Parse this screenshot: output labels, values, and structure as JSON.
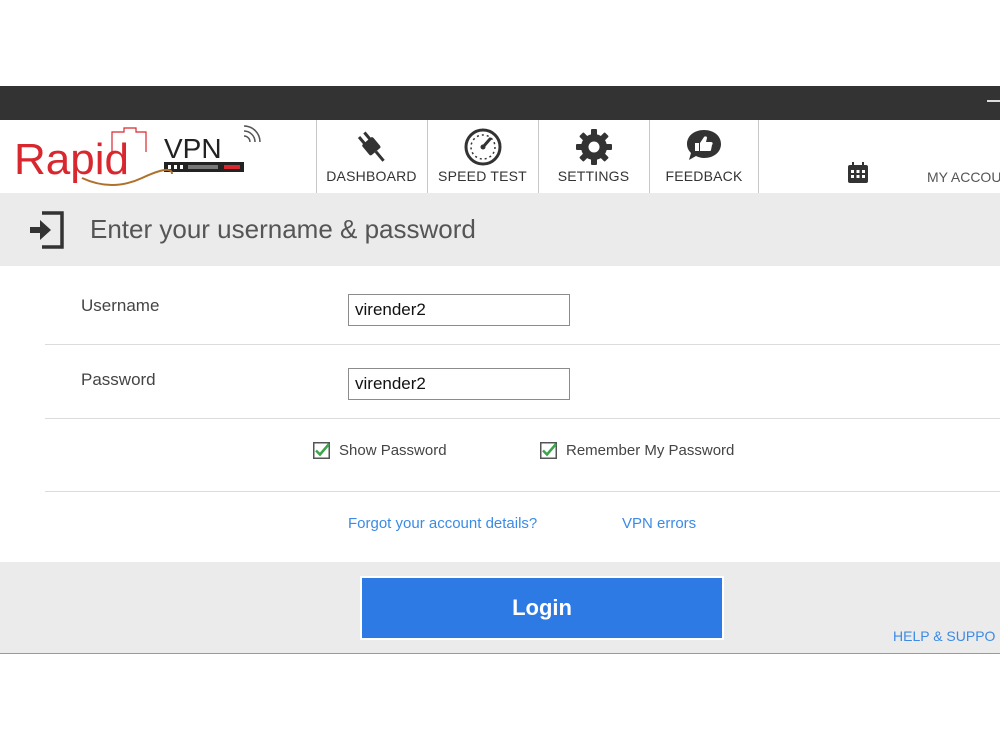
{
  "window": {
    "minimize_label": "—"
  },
  "logo": {
    "text_a": "Rapid",
    "text_b": "VPN"
  },
  "nav": {
    "items": [
      {
        "label": "DASHBOARD",
        "icon": "plug-icon"
      },
      {
        "label": "SPEED TEST",
        "icon": "speedometer-icon"
      },
      {
        "label": "SETTINGS",
        "icon": "gear-icon"
      },
      {
        "label": "FEEDBACK",
        "icon": "thumbs-up-icon"
      }
    ],
    "my_account_label": "MY ACCOU",
    "calendar_icon": "calendar-icon"
  },
  "header": {
    "title": "Enter your username & password",
    "icon": "login-icon"
  },
  "form": {
    "username_label": "Username",
    "username_value": "virender2",
    "password_label": "Password",
    "password_value": "virender2",
    "show_password_label": "Show Password",
    "show_password_checked": true,
    "remember_label": "Remember My Password",
    "remember_checked": true
  },
  "links": {
    "forgot": "Forgot your account details?",
    "vpn_errors": "VPN errors"
  },
  "footer": {
    "login_label": "Login",
    "help_label": "HELP & SUPPO"
  },
  "colors": {
    "accent": "#2d7ae5",
    "link": "#3b8be6",
    "logo_red": "#d8272e",
    "titlebar": "#333333",
    "check_green": "#3aa64a"
  }
}
